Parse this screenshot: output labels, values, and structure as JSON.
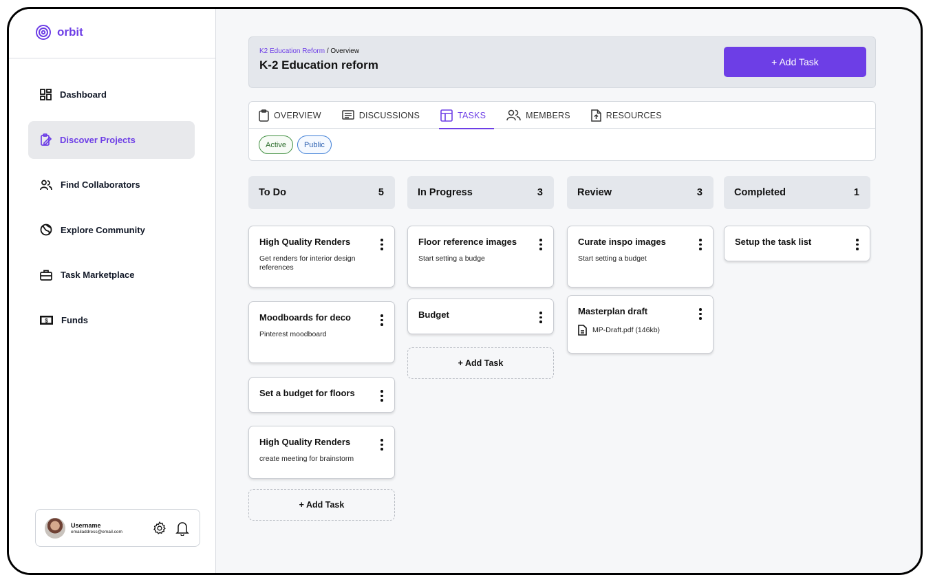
{
  "brand": {
    "name": "orbit"
  },
  "sidebar": {
    "items": [
      {
        "label": "Dashboard",
        "icon": "dashboard-icon"
      },
      {
        "label": "Discover Projects",
        "icon": "clipboard-edit-icon"
      },
      {
        "label": "Find Collaborators",
        "icon": "users-icon"
      },
      {
        "label": "Explore Community",
        "icon": "globe-icon"
      },
      {
        "label": "Task Marketplace",
        "icon": "briefcase-icon"
      },
      {
        "label": "Funds",
        "icon": "money-icon"
      }
    ],
    "active_item": "Discover Projects"
  },
  "user": {
    "name": "Username",
    "email": "emailaddress@email.com"
  },
  "project": {
    "breadcrumb_link": "K2 Education Reform",
    "breadcrumb_sep": " / ",
    "breadcrumb_current": "Overview",
    "title": "K-2 Education reform",
    "add_task_label": "+ Add Task"
  },
  "tabs": [
    {
      "label": "OVERVIEW",
      "icon": "clipboard-icon"
    },
    {
      "label": "DISCUSSIONS",
      "icon": "message-icon"
    },
    {
      "label": "TASKS",
      "icon": "layout-icon"
    },
    {
      "label": "MEMBERS",
      "icon": "users-icon"
    },
    {
      "label": "RESOURCES",
      "icon": "file-upload-icon"
    }
  ],
  "active_tab": "TASKS",
  "status_pills": [
    "Active",
    "Public"
  ],
  "colors": {
    "accent": "#6d3ee6",
    "active_pill": "#3e8e3e",
    "public_pill": "#3a7bd5"
  },
  "board": {
    "add_task_label": "+ Add Task",
    "columns": [
      {
        "title": "To Do",
        "count": "5",
        "cards": [
          {
            "title": "High Quality Renders",
            "desc": "Get renders for interior design references"
          },
          {
            "title": "Moodboards for deco",
            "desc": "Pinterest moodboard"
          },
          {
            "title": "Set a budget for floors",
            "desc": ""
          },
          {
            "title": "High Quality Renders",
            "desc": "create meeting for brainstorm"
          }
        ]
      },
      {
        "title": "In Progress",
        "count": "3",
        "cards": [
          {
            "title": "Floor reference images",
            "desc": "Start setting a budge"
          },
          {
            "title": "Budget",
            "desc": ""
          }
        ]
      },
      {
        "title": "Review",
        "count": "3",
        "cards": [
          {
            "title": "Curate inspo images",
            "desc": "Start setting a budget"
          },
          {
            "title": "Masterplan draft",
            "attachment": "MP-Draft.pdf  (146kb)"
          }
        ]
      },
      {
        "title": "Completed",
        "count": "1",
        "cards": [
          {
            "title": "Setup the task list",
            "desc": ""
          }
        ]
      }
    ]
  }
}
